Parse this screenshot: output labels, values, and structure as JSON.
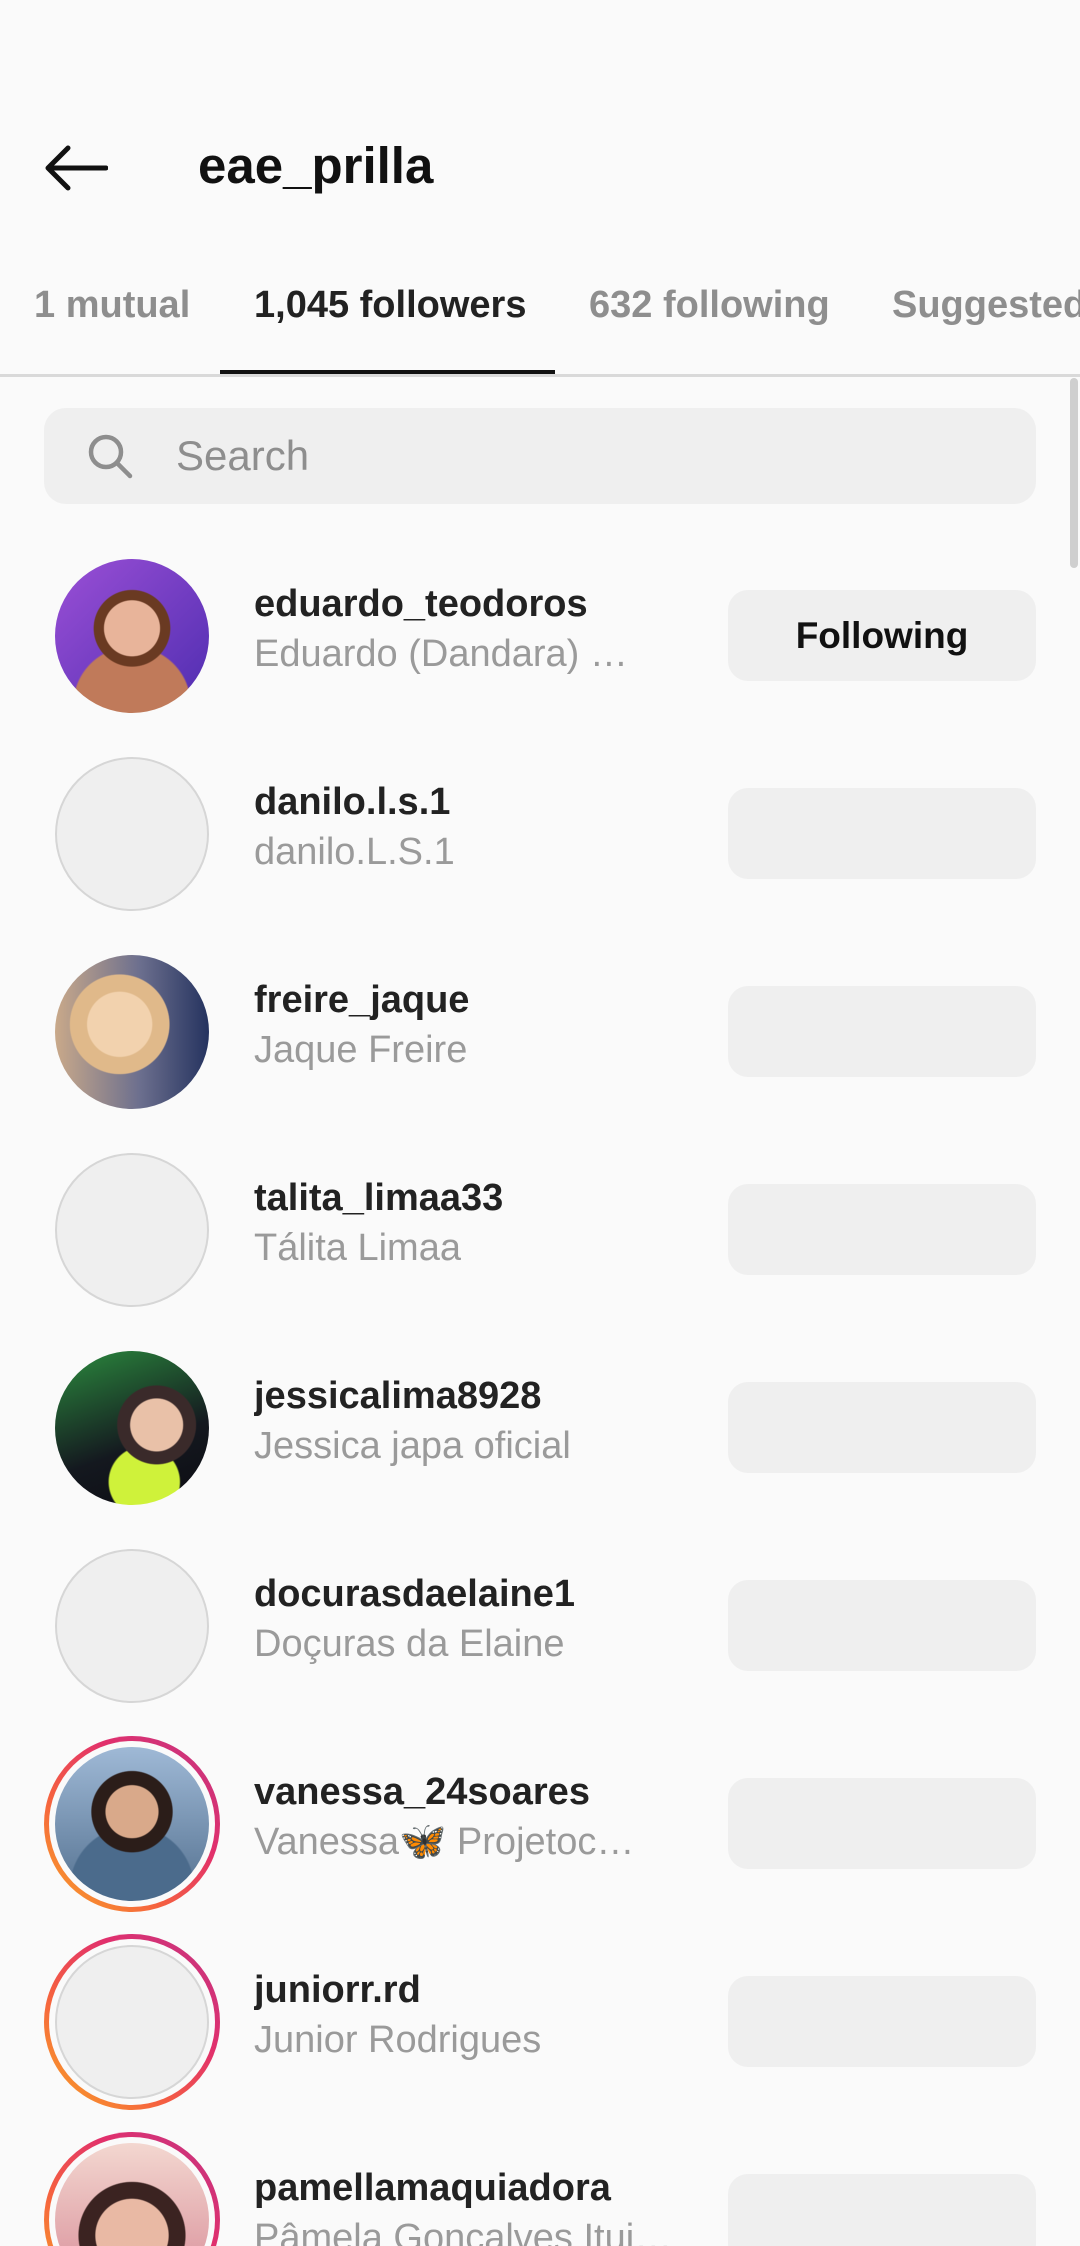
{
  "header": {
    "title": "eae_prilla",
    "back_icon": "arrow-left-icon"
  },
  "tabs": [
    {
      "label": "1 mutual",
      "active": false
    },
    {
      "label": "1,045 followers",
      "active": true
    },
    {
      "label": "632 following",
      "active": false
    },
    {
      "label": "Suggested",
      "active": false
    }
  ],
  "search": {
    "placeholder": "Search",
    "value": "",
    "icon": "search-icon"
  },
  "users": [
    {
      "username": "eduardo_teodoros",
      "fullname": "Eduardo  (Dandara)    …",
      "button": "Following",
      "story": false
    },
    {
      "username": "danilo.l.s.1",
      "fullname": "danilo.L.S.1",
      "button": "",
      "story": false
    },
    {
      "username": "freire_jaque",
      "fullname": "Jaque Freire",
      "button": "",
      "story": false
    },
    {
      "username": "talita_limaa33",
      "fullname": "Tálita Limaa",
      "button": "",
      "story": false
    },
    {
      "username": "jessicalima8928",
      "fullname": "Jessica japa oficial",
      "button": "",
      "story": false
    },
    {
      "username": "docurasdaelaine1",
      "fullname": "Doçuras da Elaine",
      "button": "",
      "story": false
    },
    {
      "username": "vanessa_24soares",
      "fullname": "Vanessa🦋      Projetoc…",
      "button": "",
      "story": true
    },
    {
      "username": "juniorr.rd",
      "fullname": "Junior Rodrigues",
      "button": "",
      "story": true
    },
    {
      "username": "pamellamaquiadora",
      "fullname": "Pâmela Gonçalves Ituiu…",
      "button": "",
      "story": true
    }
  ]
}
